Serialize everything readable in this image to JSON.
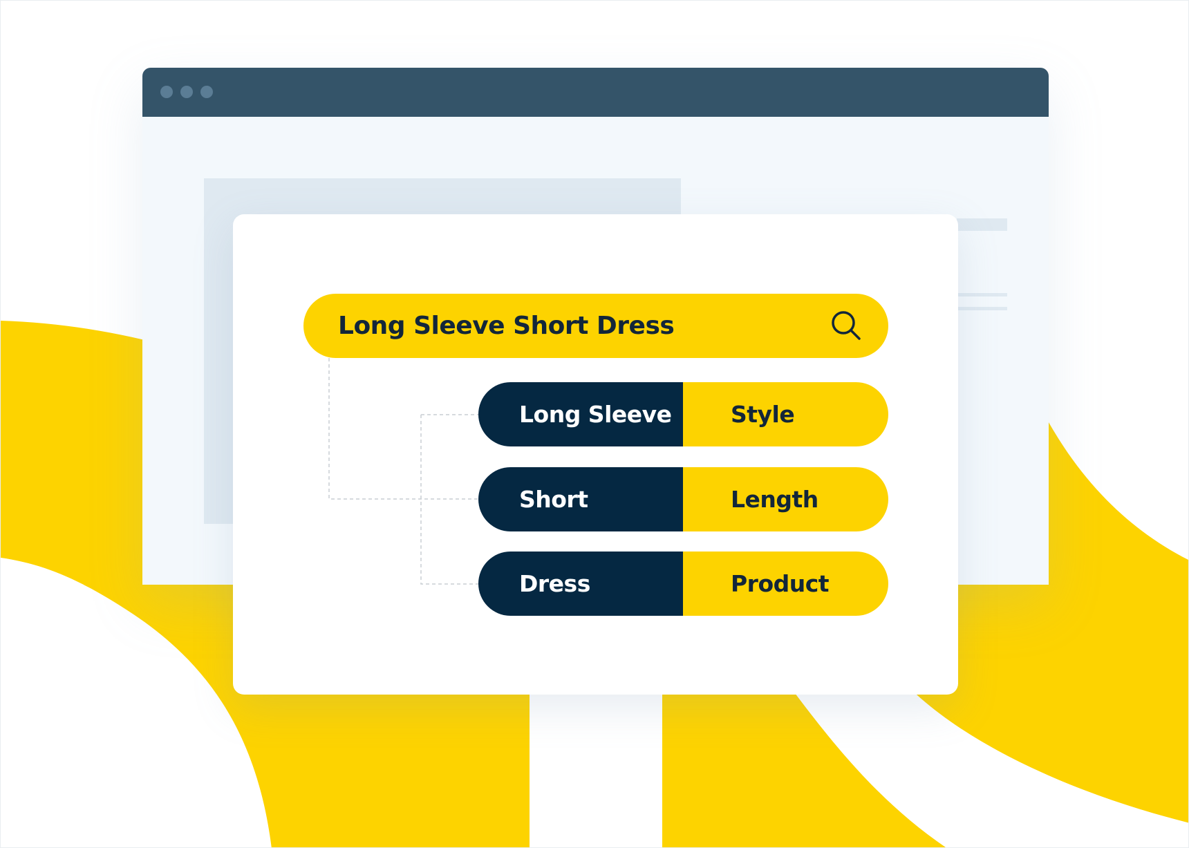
{
  "search": {
    "query": "Long Sleeve Short Dress",
    "icon": "search-icon"
  },
  "tokens": [
    {
      "term": "Long Sleeve",
      "category": "Style"
    },
    {
      "term": "Short",
      "category": "Length"
    },
    {
      "term": "Dress",
      "category": "Product"
    }
  ],
  "colors": {
    "accent_yellow": "#fdd300",
    "navy": "#052842",
    "browser_bar": "#345469",
    "browser_bg": "#f3f8fc",
    "text_dark": "#12263a"
  }
}
